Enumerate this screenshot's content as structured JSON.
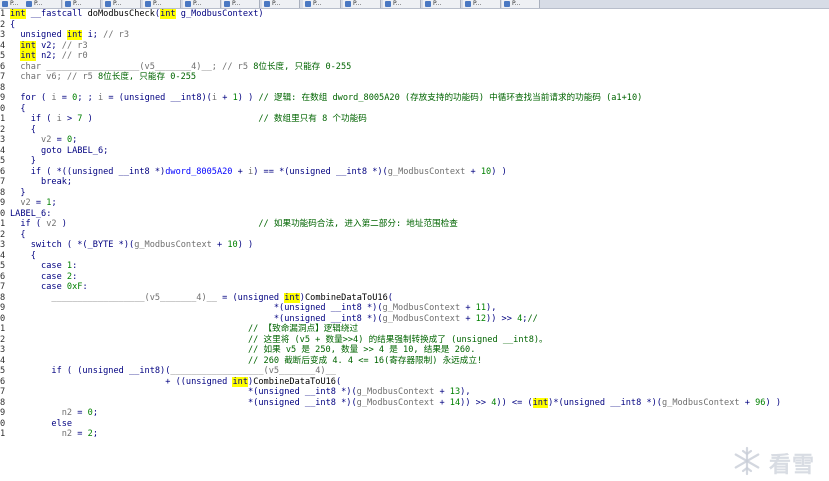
{
  "tabs": [
    {
      "label": "P..."
    },
    {
      "label": "P..."
    },
    {
      "label": "P..."
    },
    {
      "label": "P..."
    },
    {
      "label": "P..."
    },
    {
      "label": "P..."
    },
    {
      "label": "P..."
    },
    {
      "label": "P..."
    },
    {
      "label": "P..."
    },
    {
      "label": "P..."
    },
    {
      "label": "P..."
    },
    {
      "label": "P..."
    },
    {
      "label": "P..."
    },
    {
      "label": "P..."
    }
  ],
  "code": {
    "lines": [
      {
        "n": "1",
        "html": "<span class=\"hl\">int</span> __fastcall <span class=\"fn\">doModbusCheck</span>(<span class=\"hl\">int</span> g_ModbusContext)"
      },
      {
        "n": "2",
        "html": "{"
      },
      {
        "n": "3",
        "html": "  unsigned <span class=\"hl\">int</span> i; <span class=\"id\">// r3</span>"
      },
      {
        "n": "4",
        "html": "  <span class=\"hl\">int</span> v2; <span class=\"id\">// r3</span>"
      },
      {
        "n": "5",
        "html": "  <span class=\"hl\">int</span> n2; <span class=\"id\">// r0</span>"
      },
      {
        "n": "6",
        "html": "  <span class=\"id\">char __________________(v5_______4)__; // r5 </span><span class=\"cm\">8位长度, 只能存 0-255</span>"
      },
      {
        "n": "7",
        "html": "  <span class=\"id\">char v6; // r5 </span><span class=\"cm\">8位长度, 只能存 0-255</span>"
      },
      {
        "n": "8",
        "html": ""
      },
      {
        "n": "9",
        "html": "  for ( <span class=\"id\">i</span> = <span class=\"num\">0</span>; ; <span class=\"id\">i</span> = (unsigned __int8)(<span class=\"id\">i</span> + <span class=\"num\">1</span>) ) <span class=\"cm\">// 逻辑: 在数组 dword_8005A20 (存放支持的功能码) 中循环查找当前请求的功能码 (a1+10)</span>"
      },
      {
        "n": "0",
        "html": "  {"
      },
      {
        "n": "1",
        "html": "    if ( <span class=\"id\">i</span> &gt; <span class=\"num\">7</span> )                                <span class=\"cm\">// 数组里只有 8 个功能码</span>"
      },
      {
        "n": "2",
        "html": "    {"
      },
      {
        "n": "3",
        "html": "      <span class=\"id\">v2</span> = <span class=\"num\">0</span>;"
      },
      {
        "n": "4",
        "html": "      goto LABEL_6;"
      },
      {
        "n": "5",
        "html": "    }"
      },
      {
        "n": "6",
        "html": "    if ( *((unsigned __int8 *)<span class=\"gv\">dword_8005A20</span> + <span class=\"id\">i</span>) == *(unsigned __int8 *)(<span class=\"id\">g_ModbusContext</span> + <span class=\"num\">10</span>) )"
      },
      {
        "n": "7",
        "html": "      break;"
      },
      {
        "n": "8",
        "html": "  }"
      },
      {
        "n": "9",
        "html": "  <span class=\"id\">v2</span> = <span class=\"num\">1</span>;"
      },
      {
        "n": "0",
        "html": "LABEL_6:"
      },
      {
        "n": "1",
        "html": "  if ( <span class=\"id\">v2</span> )                                     <span class=\"cm\">// 如果功能码合法, 进入第二部分: 地址范围检查</span>"
      },
      {
        "n": "2",
        "html": "  {"
      },
      {
        "n": "3",
        "html": "    switch ( *(_BYTE *)(<span class=\"id\">g_ModbusContext</span> + <span class=\"num\">10</span>) )"
      },
      {
        "n": "4",
        "html": "    {"
      },
      {
        "n": "5",
        "html": "      case <span class=\"num\">1</span>:"
      },
      {
        "n": "6",
        "html": "      case <span class=\"num\">2</span>:"
      },
      {
        "n": "7",
        "html": "      case <span class=\"num\">0xF</span>:"
      },
      {
        "n": "8",
        "html": "        <span class=\"id\">__________________(v5_______4)__</span> = (unsigned <span class=\"hl\">int</span>)<span class=\"fn\">CombineDataToU16</span>("
      },
      {
        "n": "9",
        "html": "                                                   *(unsigned __int8 *)(<span class=\"id\">g_ModbusContext</span> + <span class=\"num\">11</span>),"
      },
      {
        "n": "0",
        "html": "                                                   *(unsigned __int8 *)(<span class=\"id\">g_ModbusContext</span> + <span class=\"num\">12</span>)) &gt;&gt; <span class=\"num\">4</span>;<span class=\"cm\">//</span>"
      },
      {
        "n": "1",
        "html": "                                              <span class=\"cm\">// 【致命漏洞点】逻辑绕过</span>"
      },
      {
        "n": "2",
        "html": "                                              <span class=\"cm\">// 这里将 (v5 + 数量&gt;&gt;4) 的结果强制转换成了 (unsigned __int8)。</span>"
      },
      {
        "n": "3",
        "html": "                                              <span class=\"cm\">// 如果 v5 是 250, 数量 &gt;&gt; 4 是 10, 结果是 260.</span>"
      },
      {
        "n": "4",
        "html": "                                              <span class=\"cm\">// 260 截断后变成 4. 4 &lt;= 16(寄存器限制) 永远成立!</span>"
      },
      {
        "n": "5",
        "html": "        if ( (unsigned __int8)(<span class=\"id\">__________________(v5_______4)__</span>"
      },
      {
        "n": "6",
        "html": "                              + ((unsigned <span class=\"hl\">int</span>)<span class=\"fn\">CombineDataToU16</span>("
      },
      {
        "n": "7",
        "html": "                                              *(unsigned __int8 *)(<span class=\"id\">g_ModbusContext</span> + <span class=\"num\">13</span>),"
      },
      {
        "n": "8",
        "html": "                                              *(unsigned __int8 *)(<span class=\"id\">g_ModbusContext</span> + <span class=\"num\">14</span>)) &gt;&gt; <span class=\"num\">4</span>)) &lt;= (<span class=\"hl\">int</span>)*(unsigned __int8 *)(<span class=\"id\">g_ModbusContext</span> + <span class=\"num\">96</span>) )"
      },
      {
        "n": "9",
        "html": "          <span class=\"id\">n2</span> = <span class=\"num\">0</span>;"
      },
      {
        "n": "0",
        "html": "        else"
      },
      {
        "n": "1",
        "html": "          <span class=\"id\">n2</span> = <span class=\"num\">2</span>;"
      }
    ]
  },
  "watermark": {
    "text": "看雪"
  }
}
